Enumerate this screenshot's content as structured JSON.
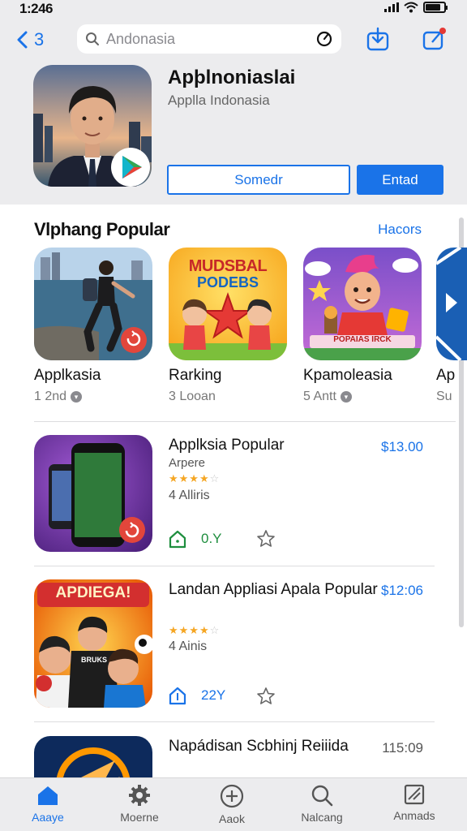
{
  "status": {
    "time": "1:246"
  },
  "header": {
    "back_label": "3",
    "search_placeholder": "Andonasia",
    "app_title": "Apþlnoniaslai",
    "app_subtitle": "Applla Indonasia",
    "btn_secondary": "Somedr",
    "btn_primary": "Entad"
  },
  "section": {
    "title": "Vlphang Popular",
    "link": "Hacors"
  },
  "cards": [
    {
      "name": "Applkasia",
      "meta": "1 2nd"
    },
    {
      "name": "Rarking",
      "meta": "3 Looan"
    },
    {
      "name": "Kpamoleasia",
      "meta": "5 Antt"
    },
    {
      "name": "Ap",
      "meta": "Su"
    }
  ],
  "card_art": {
    "banner_top": "MUDSBAL",
    "banner_bottom": "PODEBS",
    "banner3": "POPAIAS IRCK"
  },
  "rows": [
    {
      "title": "Applksia Popular",
      "developer": "Arpere",
      "stars": 4,
      "rating": "4 Alliris",
      "price": "$13.00",
      "size": "0.Y"
    },
    {
      "title": "Landan Appliasi Apala Popular",
      "stars": 4,
      "rating": "4 Ainis",
      "price": "$12:06",
      "size": "22Y",
      "poster_text": "APDIEGA!",
      "shirt_text": "BRUKS"
    },
    {
      "title": "Napádisan Scbhinj Reiiida",
      "price": "115:09"
    }
  ],
  "tabs": [
    {
      "label": "Aaaye",
      "icon": "home-icon",
      "active": true
    },
    {
      "label": "Moerne",
      "icon": "gear-icon"
    },
    {
      "label": "Aaok",
      "icon": "plus-circle-icon"
    },
    {
      "label": "Nalcang",
      "icon": "search-icon"
    },
    {
      "label": "Anmads",
      "icon": "image-box-icon"
    }
  ],
  "colors": {
    "accent": "#1a73e8",
    "star": "#f5a623",
    "green": "#1e8e3e",
    "bar": "#ececee"
  }
}
